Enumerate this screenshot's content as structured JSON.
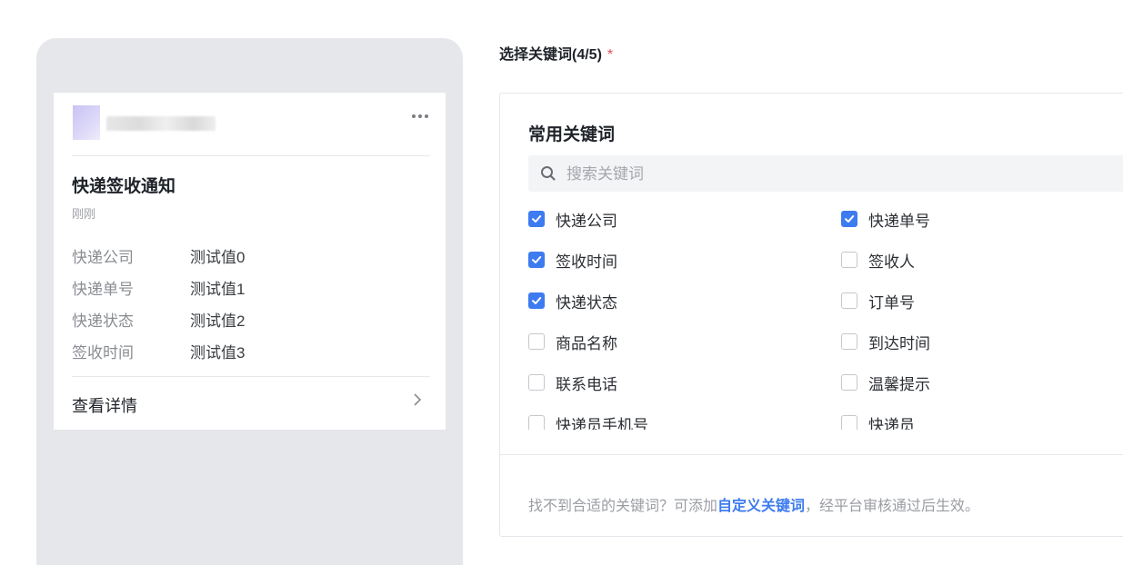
{
  "preview": {
    "title": "快递签收通知",
    "time": "刚刚",
    "fields": [
      {
        "key": "快递公司",
        "value": "测试值0"
      },
      {
        "key": "快递单号",
        "value": "测试值1"
      },
      {
        "key": "快递状态",
        "value": "测试值2"
      },
      {
        "key": "签收时间",
        "value": "测试值3"
      }
    ],
    "detail_label": "查看详情"
  },
  "keywords": {
    "section_label": "选择关键词(4/5)",
    "required_mark": "*",
    "panel_title": "常用关键词",
    "search_placeholder": "搜索关键词",
    "items": [
      {
        "label": "快递公司",
        "checked": true
      },
      {
        "label": "快递单号",
        "checked": true
      },
      {
        "label": "签收时间",
        "checked": true
      },
      {
        "label": "签收人",
        "checked": false
      },
      {
        "label": "快递状态",
        "checked": true
      },
      {
        "label": "订单号",
        "checked": false
      },
      {
        "label": "商品名称",
        "checked": false
      },
      {
        "label": "到达时间",
        "checked": false
      },
      {
        "label": "联系电话",
        "checked": false
      },
      {
        "label": "温馨提示",
        "checked": false
      },
      {
        "label": "快递员手机号",
        "checked": false
      },
      {
        "label": "快递员",
        "checked": false
      }
    ],
    "hint_prefix": "找不到合适的关键词？可添加",
    "hint_link": "自定义关键词",
    "hint_suffix": "，经平台审核通过后生效。"
  },
  "colors": {
    "accent": "#3d7bf0",
    "required": "#e34d59",
    "preview_bg": "#e6e7ea"
  }
}
